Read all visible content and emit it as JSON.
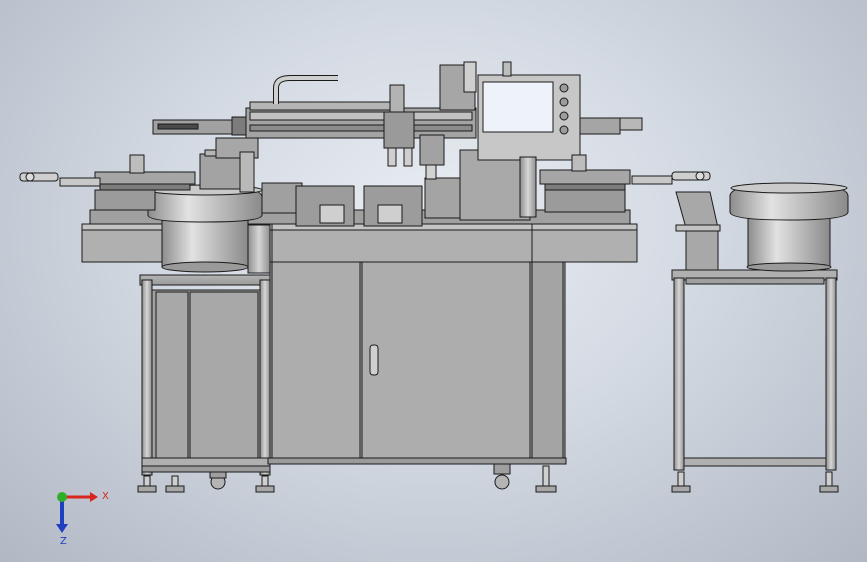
{
  "viewport": {
    "background_top": "#e9edf3",
    "background_bottom": "#b1b8c4"
  },
  "triad": {
    "x_label": "X",
    "z_label": "Z",
    "x_color": "#d8261d",
    "y_color": "#2fae2a",
    "z_color": "#1e3fbf"
  },
  "model": {
    "body_color": "#a9a9a9",
    "edge_color": "#1a1a1a",
    "screen_color": "#eef3fb",
    "screen_frame_color": "#c7c7c7"
  }
}
